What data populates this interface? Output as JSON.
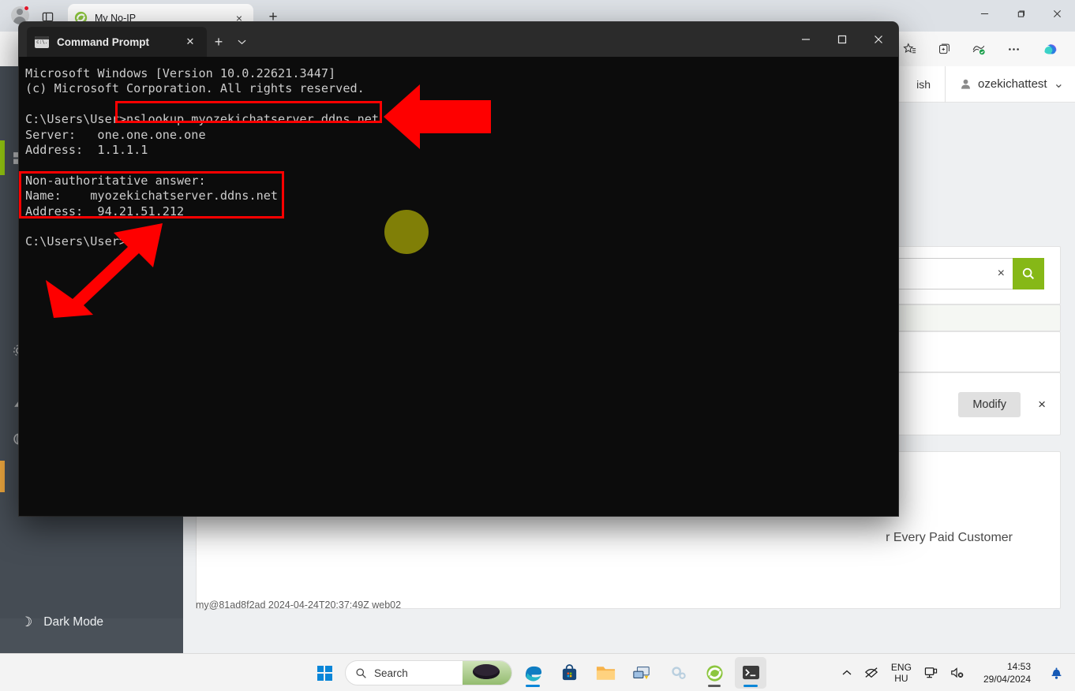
{
  "browser": {
    "tab": {
      "title": "My No-IP",
      "favicon": "noip-logo-icon",
      "close": "×"
    },
    "new_tab": "+",
    "toolbar_icons": [
      "favorites-icon",
      "collections-icon",
      "browser-essentials-icon",
      "settings-more-icon",
      "copilot-icon"
    ],
    "window_controls": {
      "minimize": "—",
      "maximize": "❐",
      "close": "✕"
    }
  },
  "webpage": {
    "language": "ish",
    "account_name": "ozekichattest",
    "account_chevron": "⌄",
    "sidebar": {
      "dark_mode_label": "Dark Mode",
      "moon_icon": "☽"
    },
    "search": {
      "clear": "×",
      "go_icon": "search-icon"
    },
    "modify_button": "Modify",
    "row_close": "×",
    "promo_text": "r Every Paid Customer",
    "footer": "my@81ad8f2ad 2024-04-24T20:37:49Z web02"
  },
  "console": {
    "tab_title": "Command Prompt",
    "tab_close": "✕",
    "new_tab": "+",
    "dropdown": "⌄",
    "window_controls": {
      "minimize": "—",
      "maximize": "□",
      "close": "✕"
    },
    "lines": [
      "Microsoft Windows [Version 10.0.22621.3447]",
      "(c) Microsoft Corporation. All rights reserved.",
      "",
      "C:\\Users\\User>nslookup myozekichatserver.ddns.net",
      "Server:   one.one.one.one",
      "Address:  1.1.1.1",
      "",
      "Non-authoritative answer:",
      "Name:    myozekichatserver.ddns.net",
      "Address:  94.21.51.212",
      "",
      "C:\\Users\\User>"
    ]
  },
  "annotations": {
    "highlight_box_command": "nslookup myozekichatserver.ddns.net",
    "highlight_box_answer": "Name: myozekichatserver.ddns.net / Address: 94.21.51.212",
    "arrow_left": "red-left-arrow",
    "arrow_diagonal": "red-diagonal-arrow",
    "click_marker": "click-highlight-dot"
  },
  "taskbar": {
    "start": "start-button",
    "search_placeholder": "Search",
    "apps": [
      "edge-icon",
      "microsoft-store-icon",
      "file-explorer-icon",
      "remote-desktop-icon",
      "weather-settings-icon",
      "noip-duc-icon",
      "terminal-icon"
    ],
    "tray": {
      "chevron": "⌃",
      "network_icon": "network-disconnected-icon",
      "language_top": "ENG",
      "language_bottom": "HU",
      "display_icon": "display-icon",
      "volume_icon": "volume-muted-icon",
      "time": "14:53",
      "date": "29/04/2024",
      "notification_icon": "notification-bell-icon"
    }
  }
}
